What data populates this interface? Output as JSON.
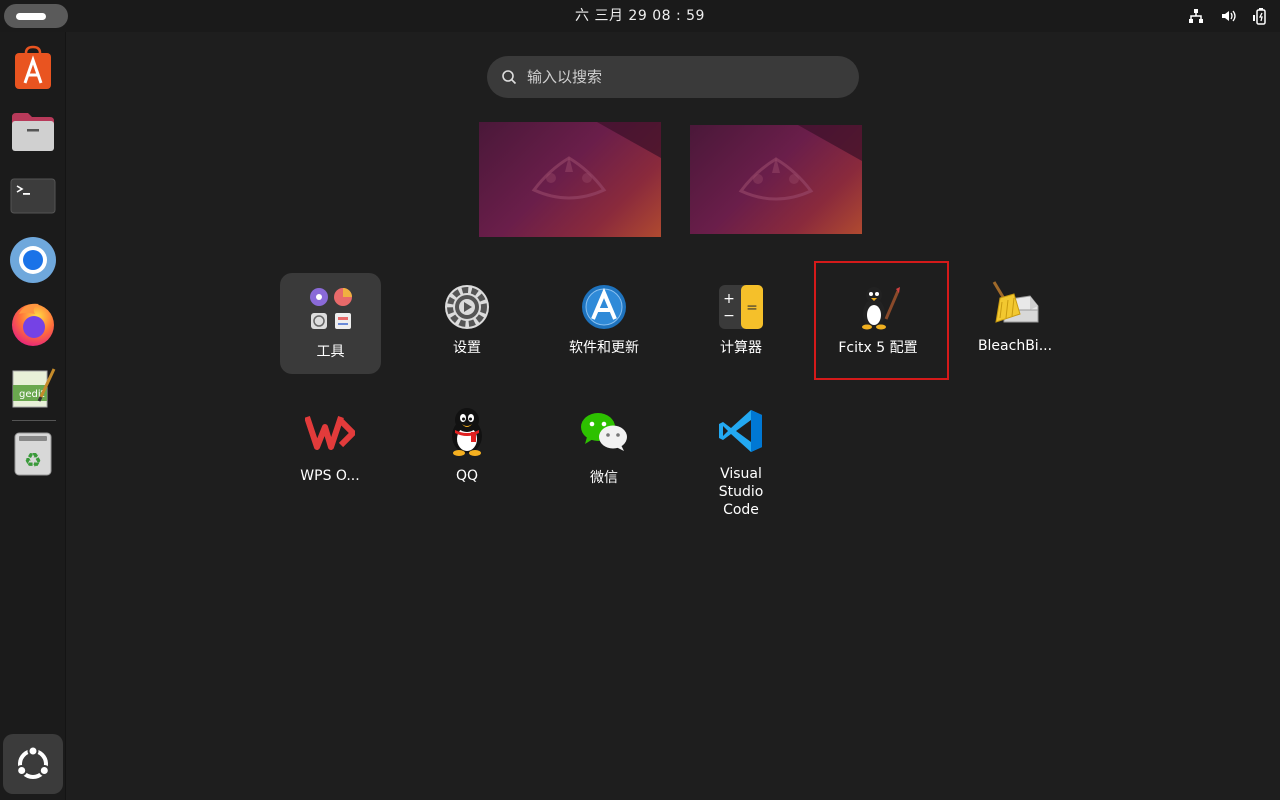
{
  "topbar": {
    "clock": "六 三月 29  08 : 59",
    "tray_icons": [
      "network-icon",
      "volume-icon",
      "battery-icon"
    ]
  },
  "dock": {
    "items": [
      {
        "name": "app-center-icon"
      },
      {
        "name": "files-icon"
      },
      {
        "name": "terminal-icon"
      },
      {
        "name": "chromium-icon"
      },
      {
        "name": "firefox-icon"
      },
      {
        "name": "text-editor-icon"
      },
      {
        "name": "trash-icon"
      }
    ],
    "show_apps_icon": "ubuntu-logo-icon"
  },
  "search": {
    "placeholder": "输入以搜索"
  },
  "apps": [
    {
      "label": "工具"
    },
    {
      "label": "设置"
    },
    {
      "label": "软件和更新"
    },
    {
      "label": "计算器"
    },
    {
      "label": "Fcitx 5 配置"
    },
    {
      "label": "BleachBi..."
    },
    {
      "label": "WPS O..."
    },
    {
      "label": "QQ"
    },
    {
      "label": "微信"
    },
    {
      "label": "Visual Studio Code"
    }
  ],
  "colors": {
    "accent_highlight": "#d41a1a",
    "background": "#1e1e1e",
    "wallpaper": "#6a1e4a"
  }
}
